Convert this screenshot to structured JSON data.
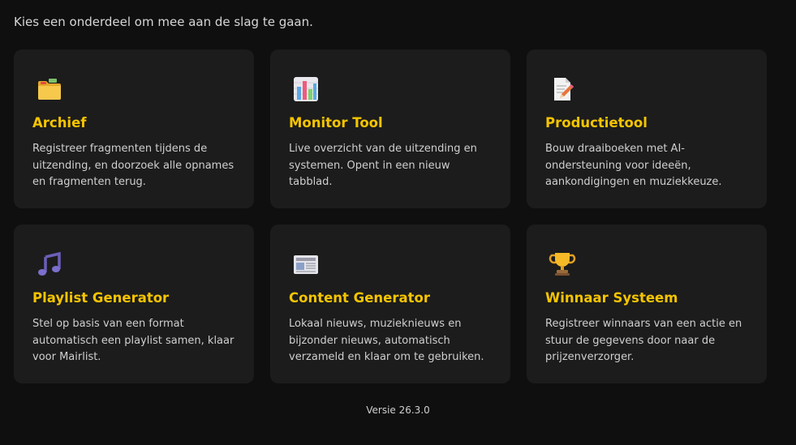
{
  "intro_text": "Kies een onderdeel om mee aan de slag te gaan.",
  "cards": [
    {
      "title": "Archief",
      "description": "Registreer fragmenten tijdens de uitzending, en doorzoek alle opnames en fragmenten terug.",
      "icon": "folder-icon"
    },
    {
      "title": "Monitor Tool",
      "description": "Live overzicht van de uitzending en systemen. Opent in een nieuw tabblad.",
      "icon": "bar-chart-icon"
    },
    {
      "title": "Productietool",
      "description": "Bouw draaiboeken met AI-ondersteuning voor ideeën, aankondigingen en muziekkeuze.",
      "icon": "document-pencil-icon"
    },
    {
      "title": "Playlist Generator",
      "description": "Stel op basis van een format automatisch een playlist samen, klaar voor Mairlist.",
      "icon": "music-note-icon"
    },
    {
      "title": "Content Generator",
      "description": "Lokaal nieuws, muzieknieuws en bijzonder nieuws, automatisch verzameld en klaar om te gebruiken.",
      "icon": "newspaper-icon"
    },
    {
      "title": "Winnaar Systeem",
      "description": "Registreer winnaars van een actie en stuur de gegevens door naar de prijzenverzorger.",
      "icon": "trophy-icon"
    }
  ],
  "version": "Versie 26.3.0",
  "colors": {
    "background": "#0f0f0f",
    "card": "#1c1c1c",
    "accent": "#f5c400"
  }
}
